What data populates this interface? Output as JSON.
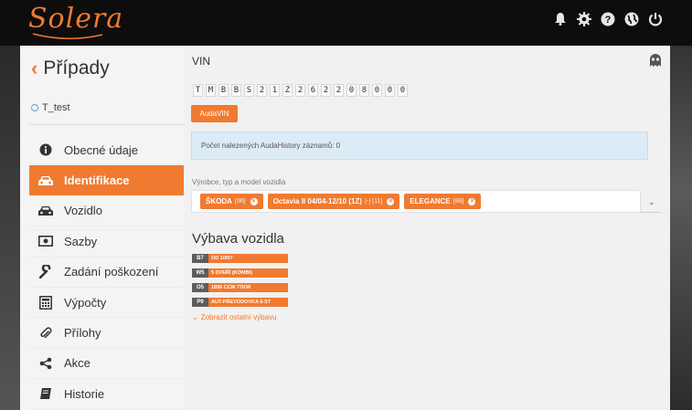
{
  "header": {
    "logo_text": "Solera",
    "icons": [
      "bell-icon",
      "gear-icon",
      "help-icon",
      "globe-icon",
      "power-icon"
    ]
  },
  "sidebar": {
    "title": "Případy",
    "user": "T_test",
    "items": [
      {
        "label": "Obecné údaje",
        "icon": "info-icon"
      },
      {
        "label": "Identifikace",
        "icon": "car-front-icon",
        "active": true
      },
      {
        "label": "Vozidlo",
        "icon": "car-icon"
      },
      {
        "label": "Sazby",
        "icon": "money-icon"
      },
      {
        "label": "Zadání poškození",
        "icon": "wrench-icon"
      },
      {
        "label": "Výpočty",
        "icon": "calculator-icon"
      },
      {
        "label": "Přílohy",
        "icon": "paperclip-icon"
      },
      {
        "label": "Akce",
        "icon": "share-icon"
      },
      {
        "label": "Historie",
        "icon": "book-icon"
      }
    ]
  },
  "main": {
    "vin_label": "VIN",
    "vin_chars": [
      "T",
      "M",
      "B",
      "B",
      "S",
      "2",
      "1",
      "Z",
      "2",
      "6",
      "2",
      "2",
      "0",
      "8",
      "0",
      "0",
      "0"
    ],
    "audavin_button": "AudaVIN",
    "info_text": "Počet nalezených AudaHistory záznamů: 0",
    "vehicle_label": "Výrobce, typ a model vozidla",
    "vehicle_tags": [
      {
        "label": "ŠKODA",
        "code": "[56]"
      },
      {
        "label": "Octavia II 04/04-12/10 (1Z)",
        "code": "[-] [11]"
      },
      {
        "label": "ELEGANCE",
        "code": "[88]"
      }
    ],
    "equipment_title": "Výbava vozidla",
    "equipment": [
      {
        "code": "B7",
        "desc": "OD 10/07"
      },
      {
        "code": "W5",
        "desc": "5 DVEŘÍ (KOMBI)"
      },
      {
        "code": "O5",
        "desc": "1896 CCM 77KW"
      },
      {
        "code": "P9",
        "desc": "AUT-PŘEVODOVKA 6-ST"
      }
    ],
    "show_more": "Zobrazit ostatní výbavu"
  },
  "colors": {
    "accent": "#f07a30",
    "topbar": "#0d0d0d",
    "info_bg": "#dcebf5"
  }
}
